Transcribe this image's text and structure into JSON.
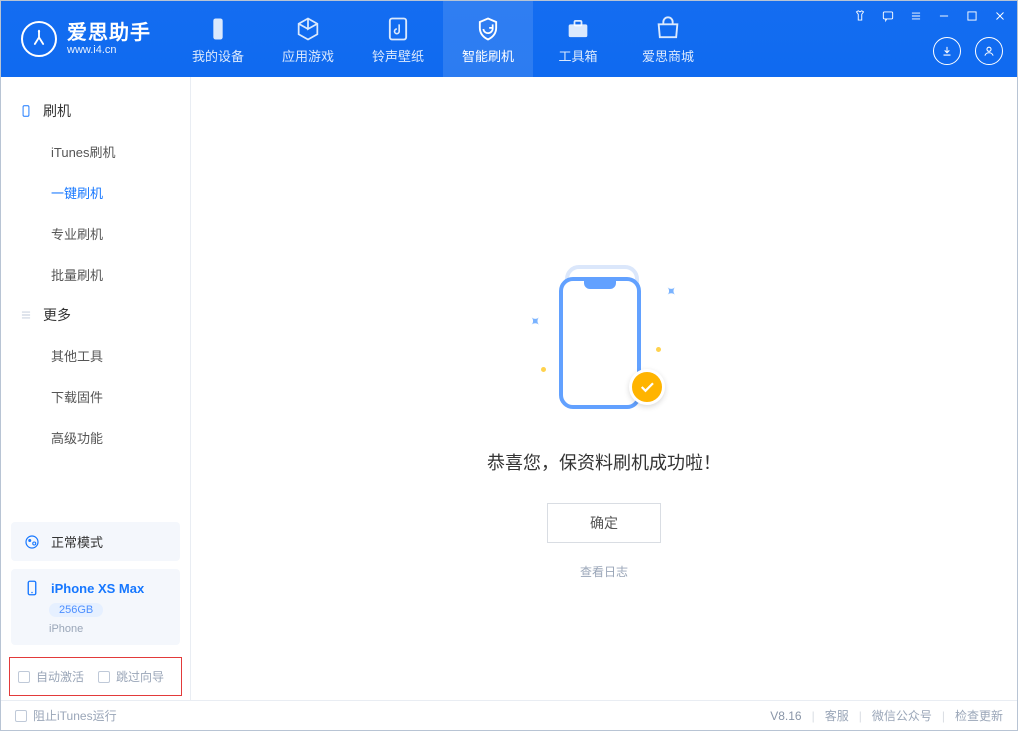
{
  "app": {
    "title": "爱思助手",
    "subtitle": "www.i4.cn"
  },
  "nav": {
    "items": [
      {
        "label": "我的设备"
      },
      {
        "label": "应用游戏"
      },
      {
        "label": "铃声壁纸"
      },
      {
        "label": "智能刷机"
      },
      {
        "label": "工具箱"
      },
      {
        "label": "爱思商城"
      }
    ]
  },
  "sidebar": {
    "groups": [
      {
        "title": "刷机",
        "items": [
          {
            "label": "iTunes刷机"
          },
          {
            "label": "一键刷机",
            "active": true
          },
          {
            "label": "专业刷机"
          },
          {
            "label": "批量刷机"
          }
        ]
      },
      {
        "title": "更多",
        "items": [
          {
            "label": "其他工具"
          },
          {
            "label": "下载固件"
          },
          {
            "label": "高级功能"
          }
        ]
      }
    ],
    "mode_label": "正常模式",
    "device": {
      "name": "iPhone XS Max",
      "capacity": "256GB",
      "type": "iPhone"
    },
    "options": {
      "auto_activate": "自动激活",
      "skip_guide": "跳过向导"
    }
  },
  "main": {
    "success_text": "恭喜您，保资料刷机成功啦！",
    "ok_button": "确定",
    "view_log": "查看日志"
  },
  "footer": {
    "block_itunes": "阻止iTunes运行",
    "version": "V8.16",
    "links": {
      "service": "客服",
      "wechat": "微信公众号",
      "update": "检查更新"
    }
  }
}
